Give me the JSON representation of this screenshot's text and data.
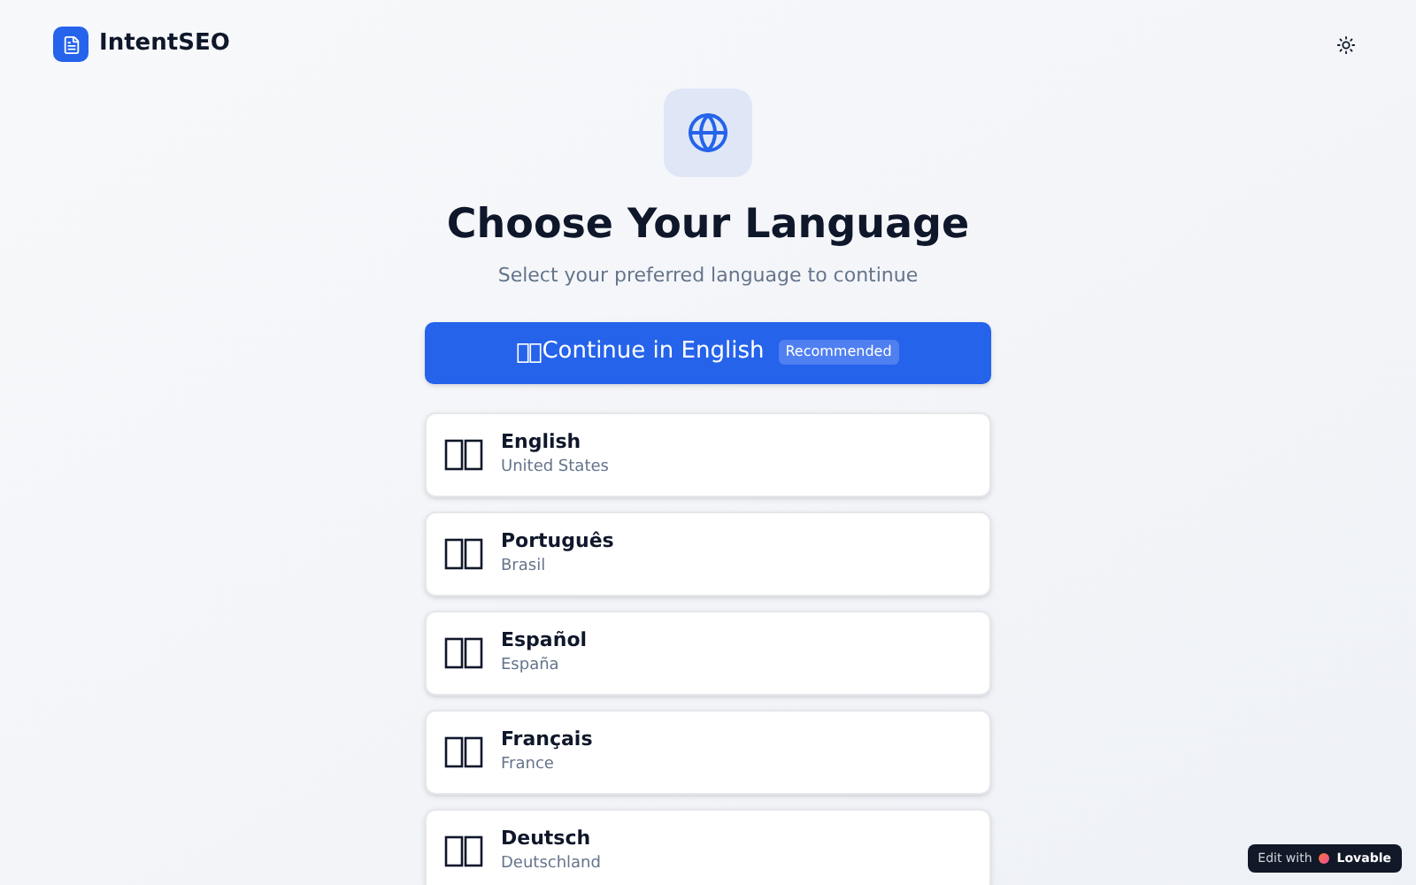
{
  "header": {
    "brand": "IntentSEO"
  },
  "title": "Choose Your Language",
  "subtitle": "Select your preferred language to continue",
  "primary_button": {
    "label": "Continue in English",
    "badge": "Recommended"
  },
  "languages": [
    {
      "name": "English",
      "region": "United States"
    },
    {
      "name": "Português",
      "region": "Brasil"
    },
    {
      "name": "Español",
      "region": "España"
    },
    {
      "name": "Français",
      "region": "France"
    },
    {
      "name": "Deutsch",
      "region": "Deutschland"
    }
  ],
  "edit_badge": {
    "label": "Edit with",
    "brand": "Lovable"
  }
}
